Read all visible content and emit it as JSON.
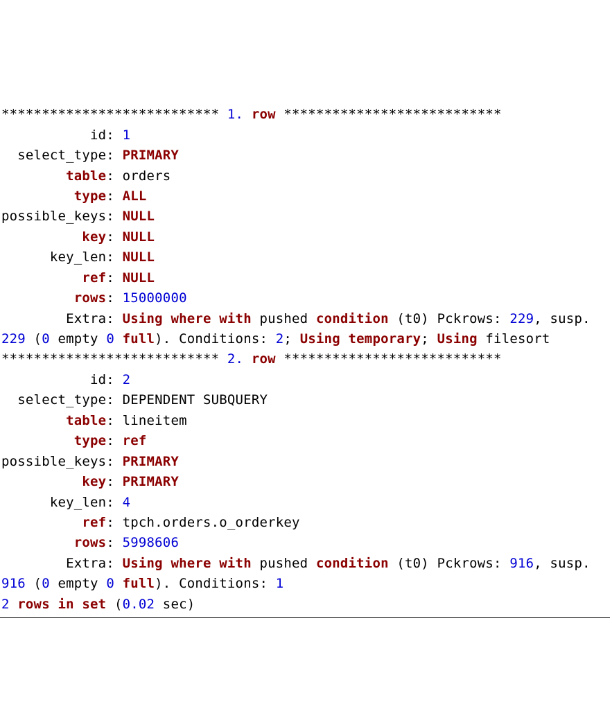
{
  "stars": "***************************",
  "rowWord": "row",
  "labels": {
    "id": "id",
    "select_type": "select_type",
    "table": "table",
    "type": "type",
    "possible_keys": "possible_keys",
    "key": "key",
    "key_len": "key_len",
    "ref": "ref",
    "rows": "rows",
    "Extra": "Extra"
  },
  "rows": [
    {
      "num": "1",
      "id": "1",
      "select_type": "PRIMARY",
      "select_type_kw": true,
      "table": "orders",
      "type": "ALL",
      "type_kw": true,
      "possible_keys": "NULL",
      "pk_kw": true,
      "key": "NULL",
      "key_kw": true,
      "key_len": "NULL",
      "key_len_kw": true,
      "ref": "NULL",
      "ref_kw": true,
      "rows": "15000000",
      "extra": {
        "pckrows": "229",
        "susp": "229",
        "empty": "0",
        "full": "0",
        "conds": "2",
        "tail_tokens": [
          {
            "t": "; ",
            "c": "txt"
          },
          {
            "t": "Using",
            "c": "kw"
          },
          {
            "t": " ",
            "c": "txt"
          },
          {
            "t": "temporary",
            "c": "kw"
          },
          {
            "t": "; ",
            "c": "txt"
          },
          {
            "t": "Using",
            "c": "kw"
          },
          {
            "t": " filesort",
            "c": "txt"
          }
        ],
        "t0": "(t0)"
      }
    },
    {
      "num": "2",
      "id": "2",
      "select_type": "DEPENDENT SUBQUERY",
      "select_type_kw": false,
      "table": "lineitem",
      "type": "ref",
      "type_kw": true,
      "possible_keys": "PRIMARY",
      "pk_kw": true,
      "key": "PRIMARY",
      "key_kw": true,
      "key_len": "4",
      "key_len_kw": false,
      "ref": "tpch.orders.o_orderkey",
      "ref_kw": false,
      "rows": "5998606",
      "extra": {
        "pckrows": "916",
        "susp": "916",
        "empty": "0",
        "full": "0",
        "conds": "1",
        "tail_tokens": [],
        "t0": "(t0)"
      }
    }
  ],
  "footer": {
    "count": "2",
    "rowsWord": "rows",
    "inWord": "in",
    "setWord": "set",
    "time": "0.02",
    "secWord": "sec"
  }
}
